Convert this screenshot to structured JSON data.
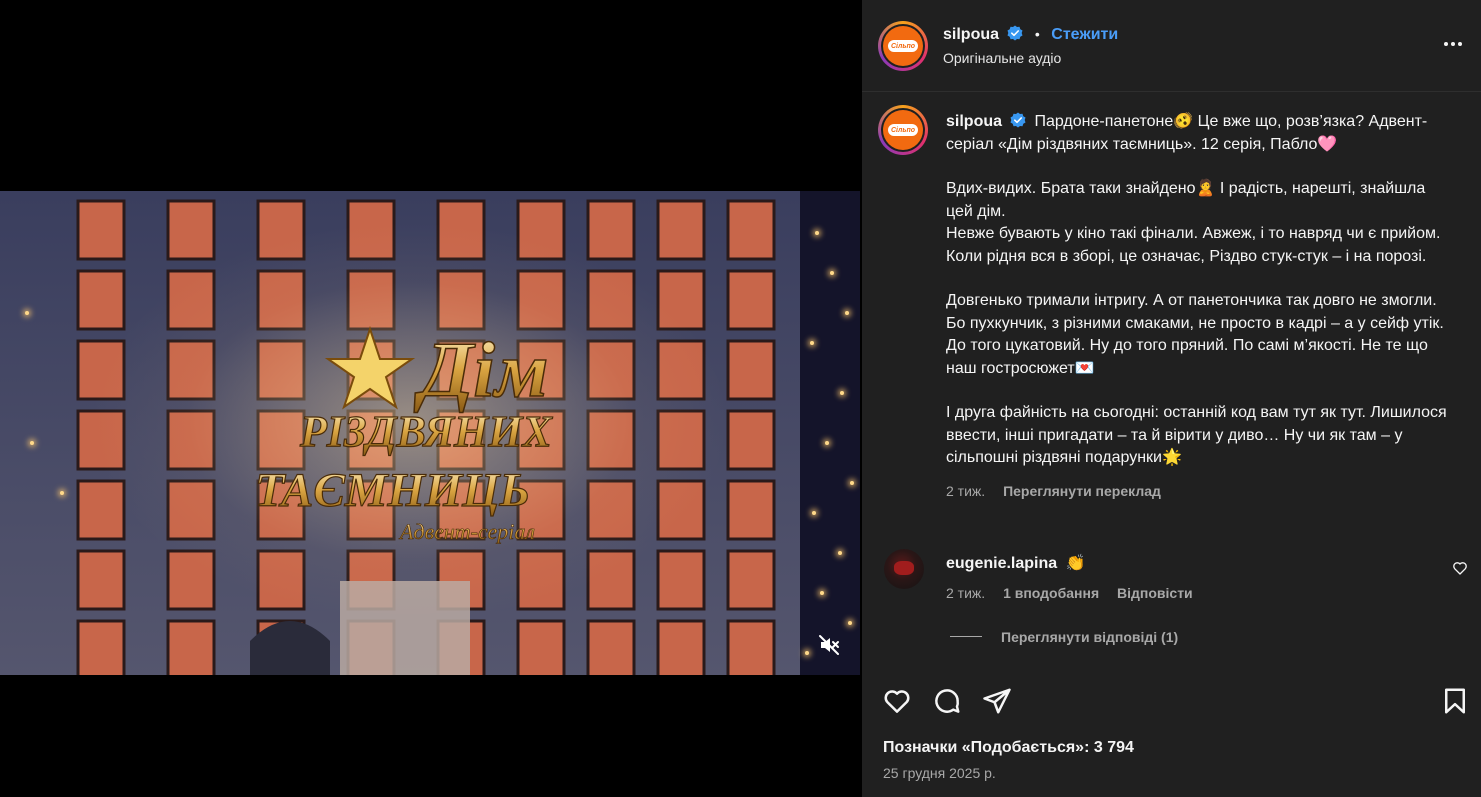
{
  "video": {
    "logo_lines": [
      "Дім",
      "РІЗДВЯНИХ",
      "ТАЄМНИЦЬ",
      "Адвент-серіал"
    ]
  },
  "header": {
    "username": "silpoua",
    "follow_label": "Стежити",
    "separator": "•",
    "audio_label": "Оригінальне аудіо",
    "avatar_text": "Сільпо"
  },
  "caption": {
    "username": "silpoua",
    "paragraphs": [
      "Пардоне-панетоне🫨 Це вже що, розв’язка? Адвент-серіал «Дім різдвяних таємниць». 12 серія, Пабло🩷",
      "Вдих-видих. Брата таки знайдено🙎 І радість, нарешті, знайшла цей дім.\nНевже бувають у кіно такі фінали. Авжеж, і то навряд чи є прийом. Коли рідня вся в зборі, це означає, Різдво стук-стук – і на порозі.",
      "Довгенько тримали інтригу. А от панетончика так довго не змогли. Бо пухкунчик, з різними смаками, не просто в кадрі – а у сейф утік. До того цукатовий. Ну до того пряний. По самі м’якості. Не те що наш гостросюжет💌",
      "І друга файність на сьогодні: останній код вам тут як тут. Лишилося ввести, інші пригадати – та й вірити у диво… Ну чи як там – у сільпошні різдвяні подарунки🌟"
    ],
    "time": "2 тиж.",
    "translate_label": "Переглянути переклад"
  },
  "comment": {
    "username": "eugenie.lapina",
    "text": "👏",
    "time": "2 тиж.",
    "likes": "1 вподобання",
    "reply_label": "Відповісти",
    "view_replies": "Переглянути відповіді (1)"
  },
  "likes_label": "Позначки «Подобається»: 3 794",
  "date": "25 грудня 2025 р.",
  "colors": {
    "panel_bg": "#202020",
    "accent": "#4a9df8",
    "brand_orange": "#f26a10",
    "secondary_text": "#a8a8a8"
  }
}
